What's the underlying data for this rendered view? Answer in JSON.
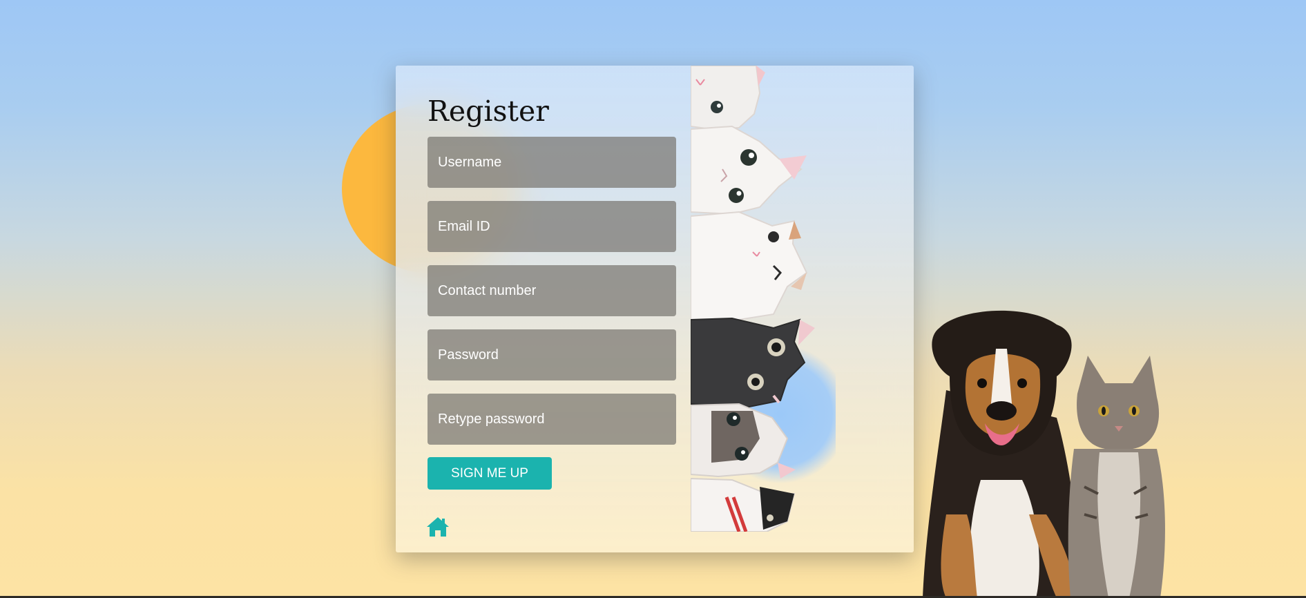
{
  "form": {
    "title": "Register",
    "fields": {
      "username_placeholder": "Username",
      "email_placeholder": "Email ID",
      "contact_placeholder": "Contact number",
      "password_placeholder": "Password",
      "retype_placeholder": "Retype password"
    },
    "submit_label": "SIGN ME UP"
  },
  "icons": {
    "home": "home-icon"
  },
  "colors": {
    "accent": "#1bb3ae",
    "sun": "#fcb83e",
    "field_bg": "#8a8a86",
    "sky_top": "#9ec7f5",
    "sky_bottom": "#fde3a4"
  }
}
